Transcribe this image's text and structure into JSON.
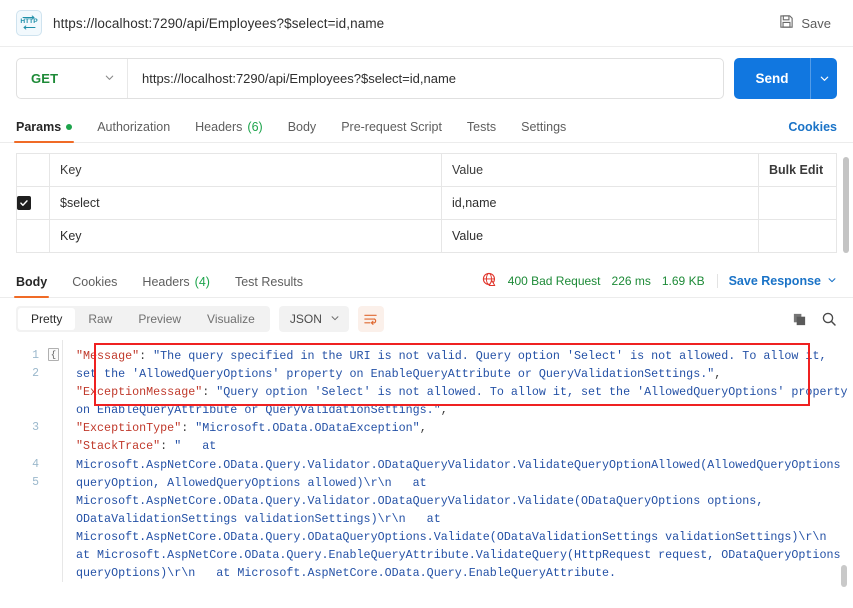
{
  "header": {
    "protocol_icon": "http-icon",
    "request_title": "https://localhost:7290/api/Employees?$select=id,name",
    "save_label": "Save",
    "save_icon": "floppy-disk-icon"
  },
  "url_bar": {
    "method": "GET",
    "method_caret": "chevron-down-icon",
    "url": "https://localhost:7290/api/Employees?$select=id,name",
    "send_label": "Send",
    "send_caret": "chevron-down-icon"
  },
  "request_tabs": {
    "items": [
      {
        "label": "Params",
        "active": true,
        "indicator": "dot",
        "count": ""
      },
      {
        "label": "Authorization",
        "active": false,
        "indicator": "",
        "count": ""
      },
      {
        "label": "Headers",
        "active": false,
        "indicator": "",
        "count": "(6)"
      },
      {
        "label": "Body",
        "active": false,
        "indicator": "",
        "count": ""
      },
      {
        "label": "Pre-request Script",
        "active": false,
        "indicator": "",
        "count": ""
      },
      {
        "label": "Tests",
        "active": false,
        "indicator": "",
        "count": ""
      },
      {
        "label": "Settings",
        "active": false,
        "indicator": "",
        "count": ""
      }
    ],
    "cookies_label": "Cookies"
  },
  "params_table": {
    "headers": {
      "key": "Key",
      "value": "Value",
      "bulk_edit": "Bulk Edit"
    },
    "rows": [
      {
        "checked": true,
        "key": "$select",
        "value": "id,name",
        "placeholder": false
      },
      {
        "checked": false,
        "key": "Key",
        "value": "Value",
        "placeholder": true
      }
    ]
  },
  "response_tabs": {
    "items": [
      {
        "label": "Body",
        "active": true,
        "count": ""
      },
      {
        "label": "Cookies",
        "active": false,
        "count": ""
      },
      {
        "label": "Headers",
        "active": false,
        "count": "(4)"
      },
      {
        "label": "Test Results",
        "active": false,
        "count": ""
      }
    ],
    "status_icon": "globe-warning-icon",
    "status": "400 Bad Request",
    "time": "226 ms",
    "size": "1.69 KB",
    "save_response_label": "Save Response",
    "save_response_caret": "chevron-down-icon"
  },
  "response_toolbar": {
    "view_modes": [
      {
        "label": "Pretty",
        "active": true
      },
      {
        "label": "Raw",
        "active": false
      },
      {
        "label": "Preview",
        "active": false
      },
      {
        "label": "Visualize",
        "active": false
      }
    ],
    "format": "JSON",
    "format_caret": "chevron-down-icon",
    "wrap_icon": "word-wrap-icon",
    "copy_icon": "copy-icon",
    "search_icon": "search-icon"
  },
  "code_viewer": {
    "line_numbers": [
      "1",
      "2",
      "3",
      "4",
      "5"
    ],
    "fold_marker": "{",
    "lines": [
      {
        "number": "1",
        "segments": [
          {
            "type": "brace",
            "text": "{"
          }
        ]
      },
      {
        "number": "2",
        "highlighted": true,
        "segments": [
          {
            "type": "key",
            "text": "\"Message\""
          },
          {
            "type": "punct",
            "text": ": "
          },
          {
            "type": "string",
            "text": "\"The query specified in the URI is not valid. Query option 'Select' is not allowed. To allow it, set the 'AllowedQueryOptions' property on EnableQueryAttribute or QueryValidationSettings.\""
          },
          {
            "type": "punct",
            "text": ","
          }
        ]
      },
      {
        "number": "3",
        "segments": [
          {
            "type": "key",
            "text": "\"ExceptionMessage\""
          },
          {
            "type": "punct",
            "text": ": "
          },
          {
            "type": "string",
            "text": "\"Query option 'Select' is not allowed. To allow it, set the 'AllowedQueryOptions' property on EnableQueryAttribute or QueryValidationSettings.\""
          },
          {
            "type": "punct",
            "text": ","
          }
        ]
      },
      {
        "number": "4",
        "segments": [
          {
            "type": "key",
            "text": "\"ExceptionType\""
          },
          {
            "type": "punct",
            "text": ": "
          },
          {
            "type": "string",
            "text": "\"Microsoft.OData.ODataException\""
          },
          {
            "type": "punct",
            "text": ","
          }
        ]
      },
      {
        "number": "5",
        "segments": [
          {
            "type": "key",
            "text": "\"StackTrace\""
          },
          {
            "type": "punct",
            "text": ": "
          },
          {
            "type": "string",
            "text": "\"   at Microsoft.AspNetCore.OData.Query.Validator.ODataQueryValidator.ValidateQueryOptionAllowed(AllowedQueryOptions queryOption, AllowedQueryOptions allowed)\\r\\n   at Microsoft.AspNetCore.OData.Query.Validator.ODataQueryValidator.Validate(ODataQueryOptions options, ODataValidationSettings validationSettings)\\r\\n   at Microsoft.AspNetCore.OData.Query.ODataQueryOptions.Validate(ODataValidationSettings validationSettings)\\r\\n   at Microsoft.AspNetCore.OData.Query.EnableQueryAttribute.ValidateQuery(HttpRequest request, ODataQueryOptions queryOptions)\\r\\n   at Microsoft.AspNetCore.OData.Query.EnableQueryAttribute."
          }
        ]
      }
    ]
  },
  "colors": {
    "accent_orange": "#f06b26",
    "send_blue": "#1177e0",
    "link_blue": "#1a73c7",
    "status_green": "#1d8a37",
    "json_key_red": "#c0392b",
    "json_string_blue": "#2451a6",
    "highlight_red": "#ef2121"
  }
}
